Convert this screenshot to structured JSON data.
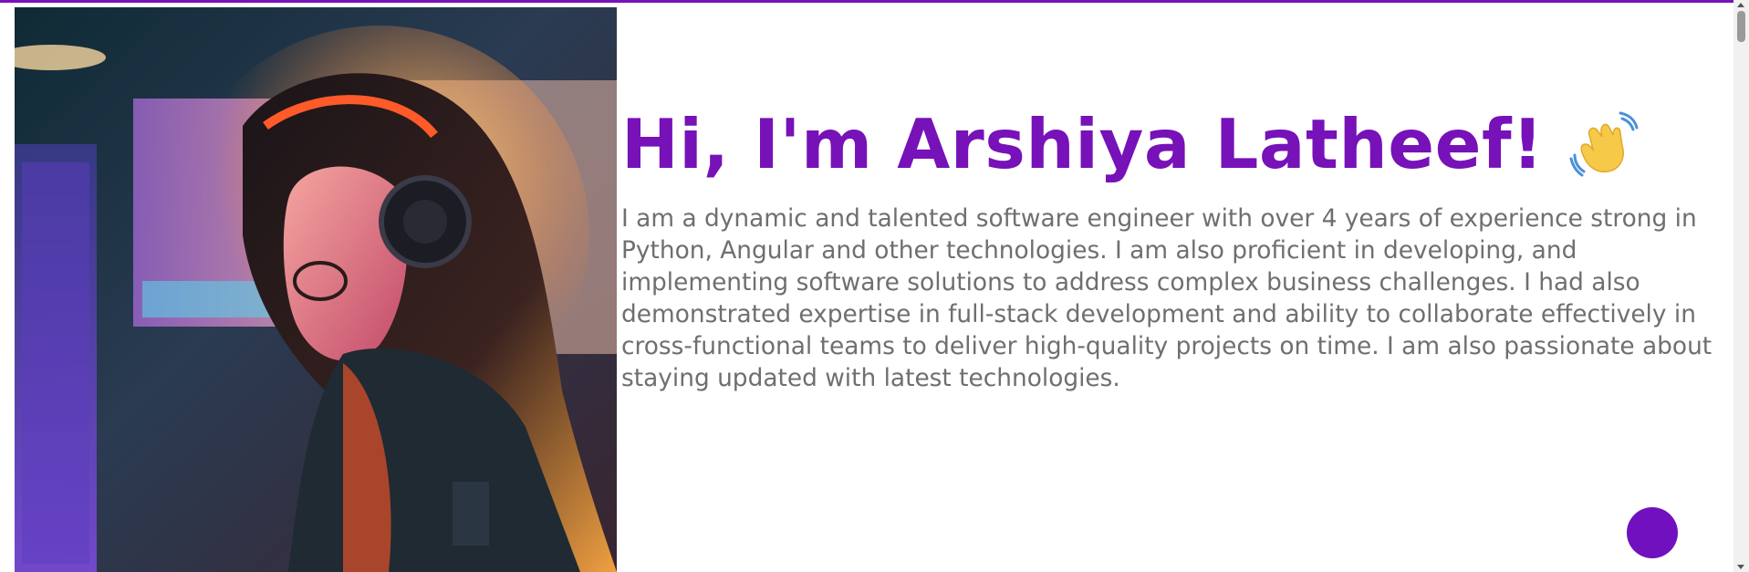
{
  "header": {
    "accent_color": "#7711b8"
  },
  "hero": {
    "image": "portrait-illustration (woman with headphones and glasses, neon-lit)",
    "title": "Hi, I'm Arshiya Latheef!",
    "emoji_icon": "waving-hand-icon",
    "bio": "I am a dynamic and talented software engineer with over 4 years of experience strong in Python, Angular and other technologies. I am also proficient in developing, and implementing software solutions to address complex business challenges. I had also demonstrated expertise in full-stack development and ability to collaborate effectively in cross-functional teams to deliver high-quality projects on time. I am also passionate about staying updated with latest technologies."
  },
  "floating_button": {
    "color": "#7010bf"
  },
  "colors": {
    "title": "#7711b8",
    "body_text": "#6f6f6f",
    "background": "#ffffff"
  }
}
